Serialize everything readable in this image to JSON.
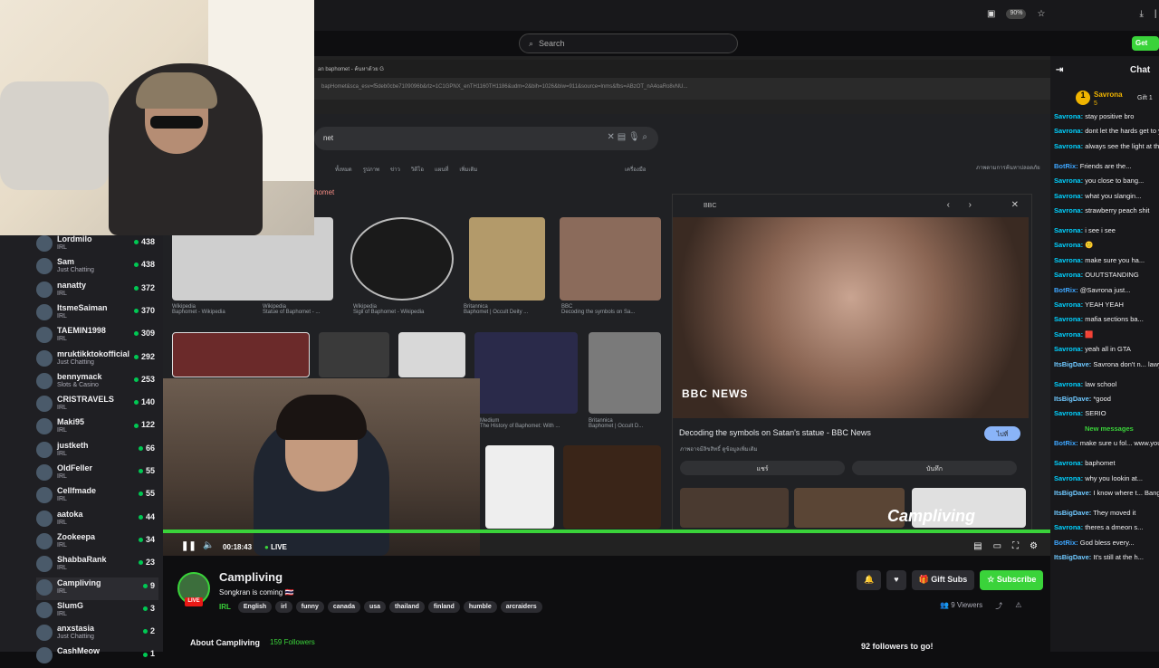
{
  "topbar": {
    "zoom": "90%",
    "search_placeholder": "Search",
    "get_label": "Get"
  },
  "viewers": [
    {
      "name": "Lordmilo",
      "sub": "IRL",
      "count": "438"
    },
    {
      "name": "Sam",
      "sub": "Just Chatting",
      "count": "438"
    },
    {
      "name": "nanatty",
      "sub": "IRL",
      "count": "372"
    },
    {
      "name": "ItsmeSaiman",
      "sub": "IRL",
      "count": "370"
    },
    {
      "name": "TAEMIN1998",
      "sub": "IRL",
      "count": "309"
    },
    {
      "name": "mruktikktokofficial",
      "sub": "Just Chatting",
      "count": "292"
    },
    {
      "name": "bennymack",
      "sub": "Slots & Casino",
      "count": "253"
    },
    {
      "name": "CRISTRAVELS",
      "sub": "IRL",
      "count": "140"
    },
    {
      "name": "Maki95",
      "sub": "IRL",
      "count": "122"
    },
    {
      "name": "justketh",
      "sub": "IRL",
      "count": "66"
    },
    {
      "name": "OldFeller",
      "sub": "IRL",
      "count": "55"
    },
    {
      "name": "Cellfmade",
      "sub": "IRL",
      "count": "55"
    },
    {
      "name": "aatoka",
      "sub": "IRL",
      "count": "44"
    },
    {
      "name": "Zookeepa",
      "sub": "IRL",
      "count": "34"
    },
    {
      "name": "ShabbaRank",
      "sub": "IRL",
      "count": "23"
    },
    {
      "name": "Campliving",
      "sub": "IRL",
      "count": "9"
    },
    {
      "name": "SlumG",
      "sub": "IRL",
      "count": "3"
    },
    {
      "name": "anxstasia",
      "sub": "Just Chatting",
      "count": "2"
    },
    {
      "name": "CashMeow",
      "sub": "",
      "count": "1"
    }
  ],
  "browser": {
    "tab_title": "an baphomet - ค้นหาด้วย G",
    "url": "bapHomet&sca_esv=f5deb0cbe7109096b&rlz=1C1GPNX_enTH1160TH1186&udm=2&bih=1026&biw=911&source=lnms&fbs=ABzOT_nA4oaRo8vNU...",
    "query": "net",
    "filters": [
      "ทั้งหมด",
      "รูปภาพ",
      "ข่าว",
      "วิดีโอ",
      "แผนที่",
      "เพิ่มเติม"
    ],
    "tools": "เครื่องมือ",
    "safe": "ภาพตามการค้นหาปลอดภัย",
    "result_label": "homet"
  },
  "results": [
    {
      "caption_src": "Wikipedia",
      "caption": "Baphomet - Wikipedia"
    },
    {
      "caption_src": "Wikipedia",
      "caption": "Statue of Baphomet - ..."
    },
    {
      "caption_src": "Wikipedia",
      "caption": "Sigil of Baphomet - Wikipedia"
    },
    {
      "caption_src": "Britannica",
      "caption": "Baphomet | Occult Deity ..."
    },
    {
      "caption_src": "BBC",
      "caption": "Decoding the symbols on Sa..."
    },
    {
      "caption_src": "Medium",
      "caption": "The History of Baphomet: With ..."
    },
    {
      "caption_src": "Britannica",
      "caption": "Baphomet | Occult D..."
    }
  ],
  "preview": {
    "source": "BBC",
    "brand": "BBC NEWS",
    "title": "Decoding the symbols on Satan's statue - BBC News",
    "note": "ภาพอาจมีลิขสิทธิ์ ดูข้อมูลเพิ่มเติม",
    "visit": "ไปที่",
    "share": "แชร์",
    "save": "บันทึก"
  },
  "overlay_text": "Campliving",
  "player": {
    "time": "00:18:43",
    "live": "LIVE"
  },
  "chat": {
    "title": "Chat",
    "top_gifter": "Savrona",
    "top_gifter_count": "5",
    "gift_label": "Gift 1",
    "messages": [
      {
        "user": "Savrona:",
        "text": "stay positive bro"
      },
      {
        "user": "Savrona:",
        "text": "dont let the hards get to you"
      },
      {
        "user": "Savrona:",
        "text": "always see the light at the end of the tunnel foe"
      },
      {
        "user": "BotRix:",
        "text": "Friends are the..."
      },
      {
        "user": "Savrona:",
        "text": "you close to bang..."
      },
      {
        "user": "Savrona:",
        "text": "what you slangin..."
      },
      {
        "user": "Savrona:",
        "text": "strawberry peach shit"
      },
      {
        "user": "Savrona:",
        "text": "i see i see"
      },
      {
        "user": "Savrona:",
        "text": "🙂"
      },
      {
        "user": "Savrona:",
        "text": "make sure you ha..."
      },
      {
        "user": "Savrona:",
        "text": "OUUTSTANDING"
      },
      {
        "user": "BotRix:",
        "text": "@Savrona just..."
      },
      {
        "user": "Savrona:",
        "text": "YEAH YEAH"
      },
      {
        "user": "Savrona:",
        "text": "mafia sections ba..."
      },
      {
        "user": "Savrona:",
        "text": "🟥"
      },
      {
        "user": "Savrona:",
        "text": "yeah all in GTA"
      },
      {
        "user": "ItsBigDave:",
        "text": "Savrona don't n... lawyer to be"
      },
      {
        "user": "Savrona:",
        "text": "law school"
      },
      {
        "user": "ItsBigDave:",
        "text": "*good"
      },
      {
        "user": "Savrona:",
        "text": "SERIO"
      },
      {
        "user": "",
        "text": "New messages"
      },
      {
        "user": "BotRix:",
        "text": "make sure u fol... www.youtube.com/@Campli..."
      },
      {
        "user": "Savrona:",
        "text": "baphomet"
      },
      {
        "user": "Savrona:",
        "text": "why you lookin at..."
      },
      {
        "user": "ItsBigDave:",
        "text": "I know where t... Bangkok is"
      },
      {
        "user": "ItsBigDave:",
        "text": "They moved it"
      },
      {
        "user": "Savrona:",
        "text": "theres a dmeon s..."
      },
      {
        "user": "BotRix:",
        "text": "God bless every..."
      },
      {
        "user": "ItsBigDave:",
        "text": "It's still at the h..."
      }
    ]
  },
  "channel": {
    "name": "Campliving",
    "title": "Songkran is coming 🇹🇭",
    "category": "IRL",
    "live_tag": "LIVE",
    "tags": [
      "English",
      "irl",
      "funny",
      "canada",
      "usa",
      "thailand",
      "finland",
      "humble",
      "arcraiders"
    ],
    "gift_subs": "Gift Subs",
    "subscribe": "Subscribe",
    "viewers": "9 Viewers",
    "about": "About Campliving",
    "followers": "159 Followers",
    "goal": "92 followers to go!"
  },
  "colors": {
    "accent": "#3ad33a",
    "chat_user": "#00d1ff",
    "live_red": "#e91916"
  }
}
